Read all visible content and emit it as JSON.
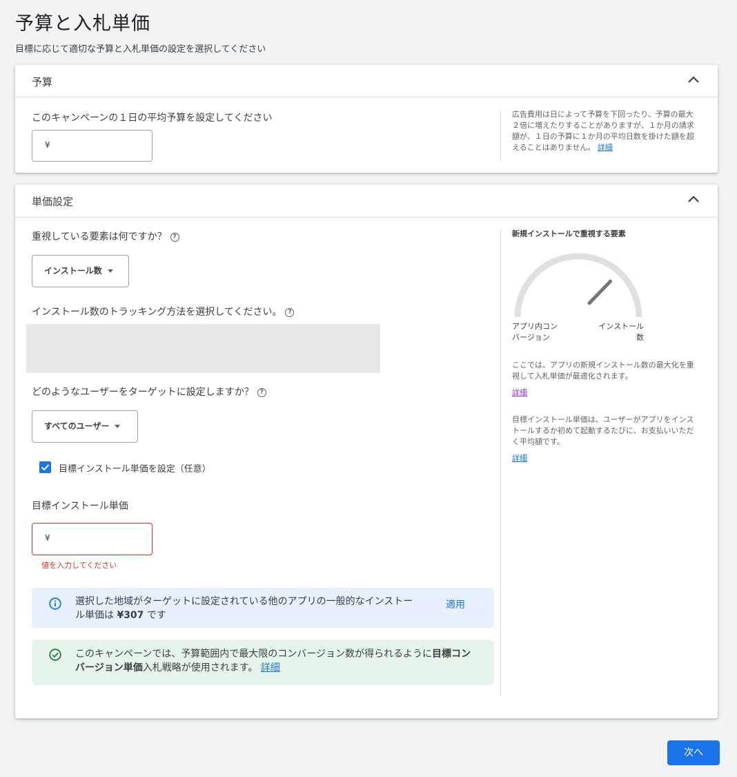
{
  "page": {
    "title": "予算と入札単価",
    "subtitle": "目標に応じて適切な予算と入札単価の設定を選択してください"
  },
  "budget": {
    "header": "予算",
    "question": "このキャンペーンの１日の平均予算を設定してください",
    "currency": "¥",
    "value": "",
    "side_text": "広告費用は日によって予算を下回ったり、予算の最大２倍に増えたりすることがありますが、１か月の請求額が、１日の予算に１か月の平均日数を掛けた額を超えることはありません。",
    "side_link": "詳細"
  },
  "bidding": {
    "header": "単価設定",
    "focus_question": "重視している要素は何ですか？",
    "focus_value": "インストール数",
    "tracking_question": "インストール数のトラッキング方法を選択してください。",
    "users_question": "どのようなユーザーをターゲットに設定しますか？",
    "users_value": "すべてのユーザー",
    "checkbox_label": "目標インストール単価を設定（任意）",
    "checkbox_checked": true,
    "target_cpi_label": "目標インストール単価",
    "target_cpi_currency": "¥",
    "target_cpi_error": "値を入力してください",
    "info_banner": {
      "line1": "選択した地域がターゲットに設定されている他のアプリの一般的なインストー",
      "line2_pre": "ル単価は ",
      "line2_value": "¥307",
      "line2_post": " です",
      "action": "適用"
    },
    "success_banner": {
      "line1_pre": "このキャンペーンでは、予算範囲内で最大限のコンバージョン数が得られるように",
      "line1_bold": "目標コン",
      "line2_bold": "バージョン単価",
      "line2_post": "入札戦略が使用されます。",
      "link": "詳細"
    },
    "side": {
      "title": "新規インストールで重視する要素",
      "gauge_left_line1": "アプリ内コン",
      "gauge_left_line2": "バージョン",
      "gauge_right_line1": "インストール",
      "gauge_right_line2": "数",
      "gauge_level": 0.85,
      "text1": "ここでは、アプリの新規インストール数の最大化を重視して入札単価が最適化されます。",
      "link1": "詳細",
      "text2": "目標インストール単価は、ユーザーがアプリをインストールするか初めて起動するたびに、お支払いいただく平均額です。",
      "link2": "詳細"
    }
  },
  "footer": {
    "next_label": "次へ"
  },
  "colors": {
    "primary": "#1a73e8",
    "error": "#d93025",
    "success": "#188038",
    "info_bg": "#e8f0fe",
    "success_bg": "#e6f4ea"
  }
}
